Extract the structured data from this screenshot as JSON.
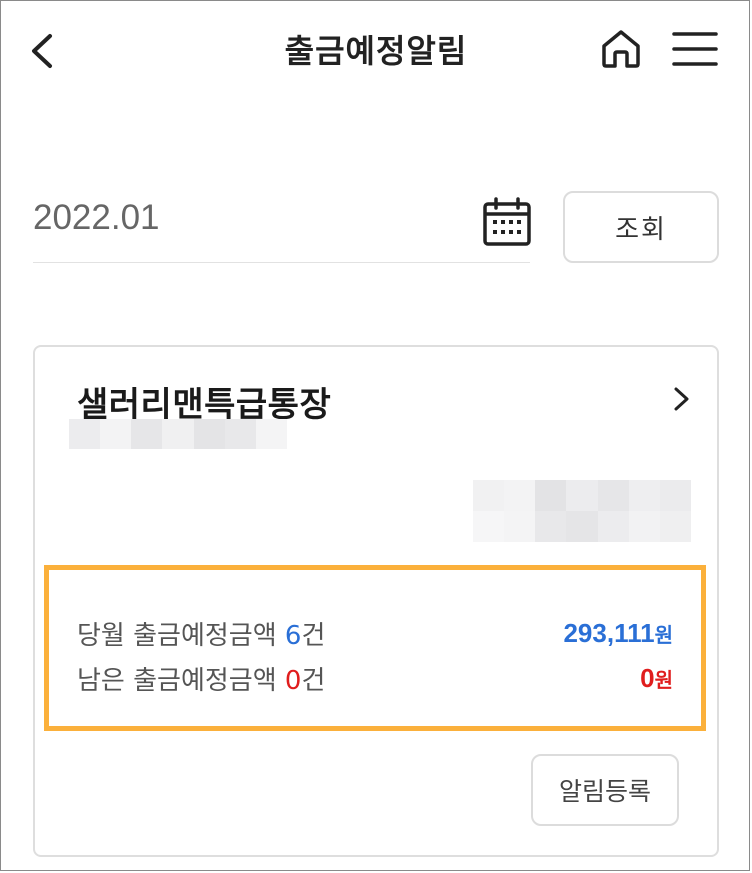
{
  "header": {
    "title": "출금예정알림",
    "back_icon": "chevron-left-icon",
    "home_icon": "home-icon",
    "menu_icon": "hamburger-menu-icon"
  },
  "filter": {
    "date_value": "2022.01",
    "calendar_icon": "calendar-icon",
    "search_label": "조회"
  },
  "account_card": {
    "account_name": "샐러리맨특급통장",
    "account_number": "",
    "balance": "",
    "chevron_icon": "chevron-right-icon",
    "summary": {
      "row1": {
        "label_prefix": "당월 출금예정금액 ",
        "count": "6",
        "count_suffix": "건",
        "amount": "293,111",
        "unit": "원"
      },
      "row2": {
        "label_prefix": "남은 출금예정금액 ",
        "count": "0",
        "count_suffix": "건",
        "amount": "0",
        "unit": "원"
      }
    },
    "register_label": "알림등록"
  },
  "colors": {
    "accent_blue": "#2a6fd6",
    "accent_red": "#e01d1d",
    "highlight_orange": "#fbb03b"
  }
}
